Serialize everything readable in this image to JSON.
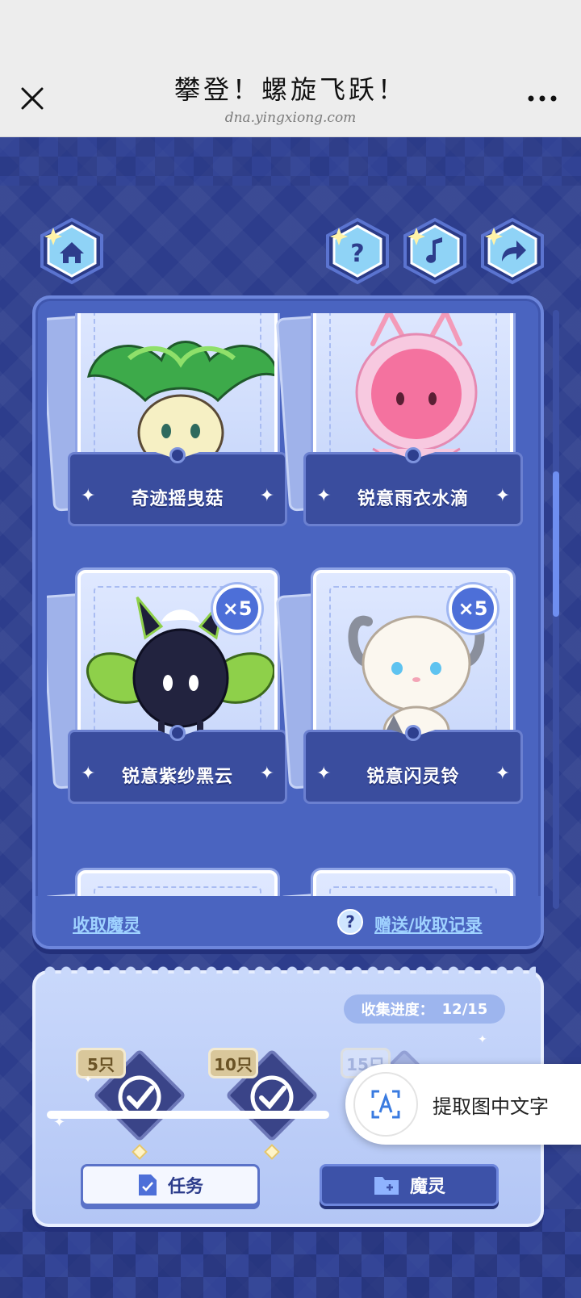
{
  "titlebar": {
    "title": "攀登！螺旋飞跃！",
    "url": "dna.yingxiong.com",
    "close_icon": "close-icon",
    "more_icon": "more-icon"
  },
  "nav": {
    "home_icon": "home-icon",
    "help_icon": "help-icon",
    "music_icon": "music-icon",
    "share_icon": "share-icon"
  },
  "cards": [
    {
      "name": "奇迹摇曳菇",
      "count": "",
      "creature": "green-mushroom-creature"
    },
    {
      "name": "锐意雨衣水滴",
      "count": "",
      "creature": "pink-droplet-creature"
    },
    {
      "name": "锐意紫纱黑云",
      "count": "×5",
      "creature": "black-cloud-creature"
    },
    {
      "name": "锐意闪灵铃",
      "count": "×5",
      "creature": "white-goat-bell-creature"
    }
  ],
  "panel_footer": {
    "receive_label": "收取魔灵",
    "help_symbol": "?",
    "records_label": "赠送/收取记录"
  },
  "progress": {
    "label": "收集进度：",
    "value": "12/15",
    "collected": 12,
    "total": 15,
    "milestones": [
      {
        "tag": "5只",
        "achieved": true
      },
      {
        "tag": "10只",
        "achieved": true
      },
      {
        "tag": "15只",
        "achieved": false
      }
    ]
  },
  "buttons": {
    "task_label": "任务",
    "spirit_label": "魔灵"
  },
  "ocr": {
    "label": "提取图中文字"
  },
  "colors": {
    "background": "#2d3d8c",
    "panel": "#4a64c0",
    "link": "#9fd2ff",
    "accent": "#6e8ef0"
  }
}
